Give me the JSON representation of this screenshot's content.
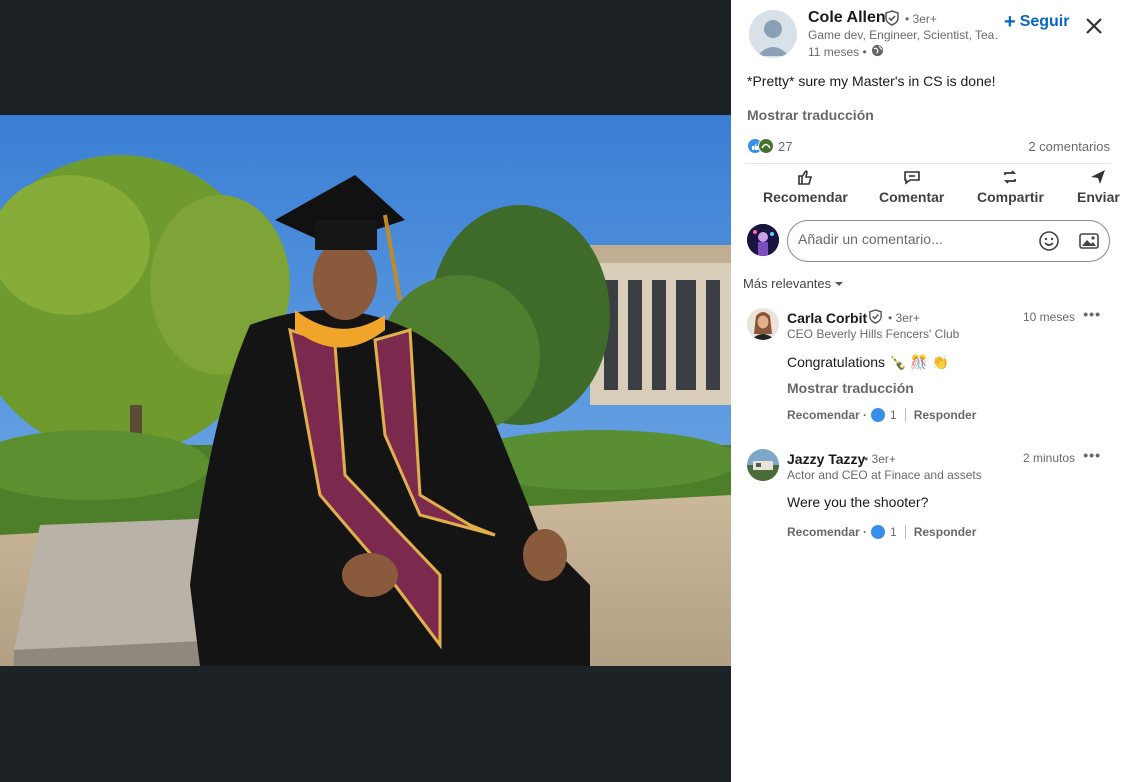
{
  "post": {
    "author_name": "Cole Allen",
    "author_degree": "• 3er+",
    "author_headline": "Game dev, Engineer, Scientist, Tea…",
    "time": "11 meses •",
    "follow_label": "Seguir",
    "text": "*Pretty* sure my Master's in CS is done!",
    "show_translation": "Mostrar traducción",
    "reaction_count": "27",
    "comment_count": "2 comentarios"
  },
  "actions": {
    "like": "Recomendar",
    "comment": "Comentar",
    "repost": "Compartir",
    "send": "Enviar"
  },
  "comment_input": {
    "placeholder": "Añadir un comentario..."
  },
  "sort_label": "Más relevantes",
  "comments": [
    {
      "name": "Carla Corbit",
      "degree": "• 3er+",
      "headline": "CEO Beverly Hills Fencers' Club",
      "time": "10 meses",
      "text": "Congratulations 🍾 🎊 👏",
      "show_translation": "Mostrar traducción",
      "like_label": "Recomendar ·",
      "like_count": "1",
      "reply_label": "Responder"
    },
    {
      "name": "Jazzy Tazzy",
      "degree": "• 3er+",
      "headline": "Actor and CEO at Finace and assets",
      "time": "2 minutos",
      "text": "Were you the shooter?",
      "like_label": "Recomendar ·",
      "like_count": "1",
      "reply_label": "Responder"
    }
  ],
  "colors": {
    "brand_blue": "#0a66c2",
    "media_bg": "#1d2226",
    "like_blue": "#378fe9"
  },
  "icons": {
    "verified": "shield-check-icon",
    "globe": "globe-icon",
    "close": "close-icon",
    "like": "thumbs-up-icon",
    "comment": "speech-bubble-icon",
    "repost": "repost-arrows-icon",
    "send": "paper-plane-icon",
    "emoji": "smiley-icon",
    "image": "image-icon",
    "more": "ellipsis-icon",
    "caret": "caret-down-icon"
  }
}
